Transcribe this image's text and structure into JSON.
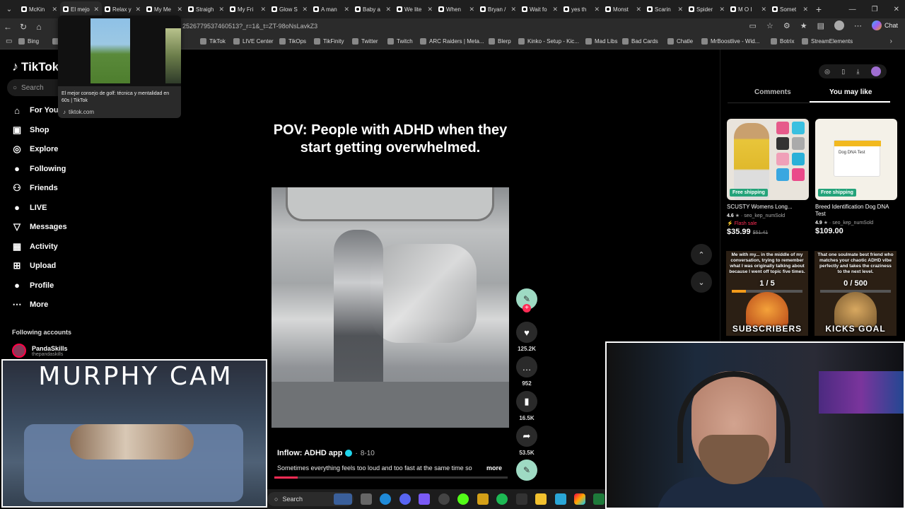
{
  "browser": {
    "tabs": [
      {
        "label": "McKin"
      },
      {
        "label": "El mejo",
        "active": true
      },
      {
        "label": "Relax y"
      },
      {
        "label": "My Me"
      },
      {
        "label": "Straigh"
      },
      {
        "label": "My Fri"
      },
      {
        "label": "Glow S"
      },
      {
        "label": "A man"
      },
      {
        "label": "Baby a"
      },
      {
        "label": "We lite"
      },
      {
        "label": "When"
      },
      {
        "label": "Bryan /"
      },
      {
        "label": "Wait fo"
      },
      {
        "label": "yes th"
      },
      {
        "label": "Monst"
      },
      {
        "label": "Scarin"
      },
      {
        "label": "Spider"
      },
      {
        "label": "M O I"
      },
      {
        "label": "Somet"
      }
    ],
    "url_fragment": "2526779537460513?_r=1&_t=ZT-98oNsLavkZ3",
    "chat_label": "Chat",
    "bookmarks": [
      "Bing",
      "ube",
      "TikTok",
      "LIVE Center",
      "TikOps",
      "TikFinity",
      "Twitter",
      "Twitch",
      "ARC Raiders | Meta...",
      "Blerp",
      "Kinko - Setup - Kic...",
      "Mad Libs",
      "Bad Cards",
      "Chatle",
      "MrBoostlive - Wid...",
      "Botrix",
      "StreamElements"
    ]
  },
  "tab_preview": {
    "title": "El mejor consejo de golf: técnica y mentalidad en 60s | TikTok",
    "domain": "tiktok.com"
  },
  "tiktok": {
    "logo": "TikTok",
    "search_placeholder": "Search",
    "nav": [
      {
        "label": "For You",
        "icon": "home-icon"
      },
      {
        "label": "Shop",
        "icon": "shop-icon"
      },
      {
        "label": "Explore",
        "icon": "compass-icon"
      },
      {
        "label": "Following",
        "icon": "following-icon"
      },
      {
        "label": "Friends",
        "icon": "friends-icon"
      },
      {
        "label": "LIVE",
        "icon": "live-icon"
      },
      {
        "label": "Messages",
        "icon": "messages-icon"
      },
      {
        "label": "Activity",
        "icon": "activity-icon"
      },
      {
        "label": "Upload",
        "icon": "upload-icon"
      },
      {
        "label": "Profile",
        "icon": "profile-icon"
      },
      {
        "label": "More",
        "icon": "more-icon"
      }
    ],
    "following_accounts_heading": "Following accounts",
    "following_account": {
      "name": "PandaSkills",
      "handle": "thepandaskills"
    },
    "video": {
      "overlay_caption": "POV: People with ADHD when they start getting overwhelmed.",
      "author": "Inflow: ADHD app",
      "date": "8-10",
      "description": "Sometimes everything feels too loud and too fast at the same time so",
      "more_label": "more",
      "progress": 0.1
    },
    "actions": {
      "likes": "125.2K",
      "comments": "952",
      "saves": "16.5K",
      "shares": "53.5K"
    },
    "right_panel": {
      "tabs": [
        "Comments",
        "You may like"
      ],
      "active_tab": "You may like",
      "products": [
        {
          "badge": "Free shipping",
          "name": "SCUSTY Womens Long...",
          "rating": "4.6",
          "seller": "seo_kep_numSold",
          "flash": "Flash sale",
          "price": "$35.99",
          "old_price": "$51.41"
        },
        {
          "badge": "Free shipping",
          "name": "Breed Identification Dog DNA Test",
          "rating": "4.9",
          "seller": "seo_kep_numSold",
          "price": "$109.00",
          "box_text": "Dog DNA Test"
        }
      ]
    }
  },
  "stream_overlays": {
    "subscribers_goal": {
      "text": "Me with my... in the middle of my conversation, trying to remember what I was originally talking about because I went off topic five times.",
      "count": "1 / 5",
      "label": "SUBSCRIBERS",
      "progress": 0.2
    },
    "kicks_goal": {
      "text": "That one soulmate best friend who matches your chaotic ADHD vibe perfectly and takes the craziness to the next level.",
      "count": "0 / 500",
      "label": "KICKS GOAL",
      "progress": 0
    },
    "murphy_cam_title": "MURPHY CAM"
  },
  "taskbar": {
    "search_label": "Search"
  },
  "colors": {
    "tiktok_red": "#fe2c55",
    "free_shipping_green": "#24a37a",
    "verified_blue": "#20d5ec"
  }
}
